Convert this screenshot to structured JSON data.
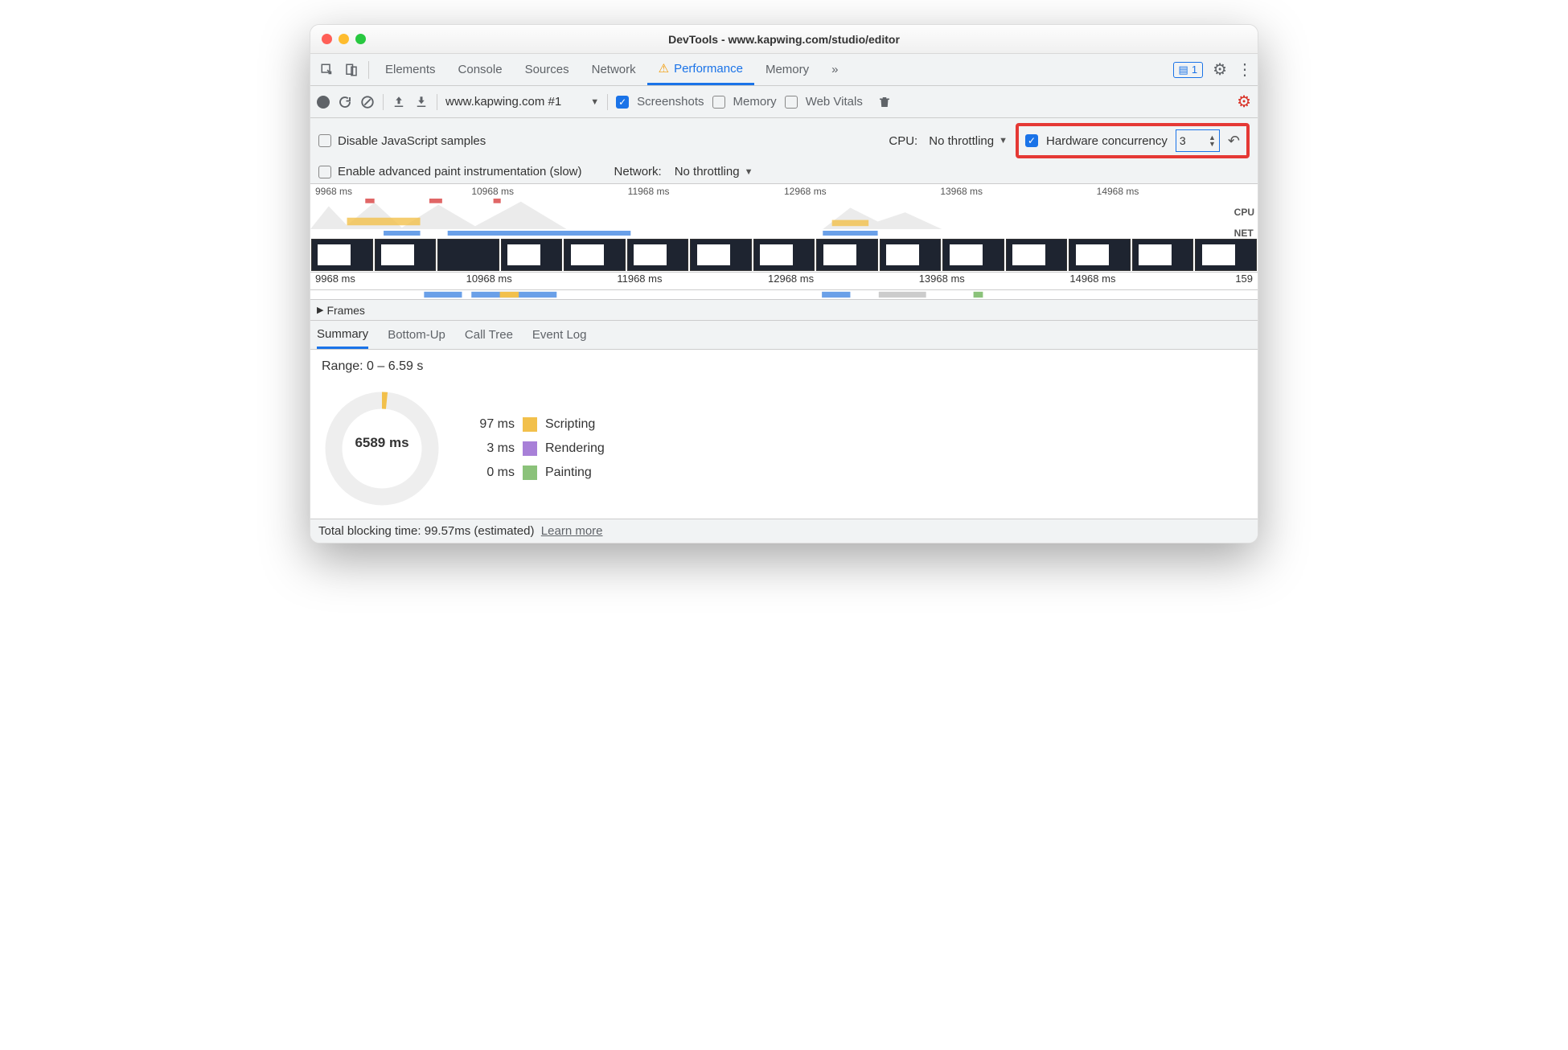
{
  "window_title": "DevTools - www.kapwing.com/studio/editor",
  "tabs": [
    "Elements",
    "Console",
    "Sources",
    "Network",
    "Performance",
    "Memory"
  ],
  "active_tab": "Performance",
  "messages_count": "1",
  "recording_target": "www.kapwing.com #1",
  "capture": {
    "screenshots_label": "Screenshots",
    "memory_label": "Memory",
    "webvitals_label": "Web Vitals",
    "screenshots_checked": true,
    "memory_checked": false,
    "webvitals_checked": false
  },
  "options": {
    "disable_js_label": "Disable JavaScript samples",
    "cpu_label": "CPU:",
    "cpu_value": "No throttling",
    "hw_label": "Hardware concurrency",
    "hw_value": "3",
    "enable_paint_label": "Enable advanced paint instrumentation (slow)",
    "network_label": "Network:",
    "network_value": "No throttling"
  },
  "overview_ticks": [
    "9968 ms",
    "10968 ms",
    "11968 ms",
    "12968 ms",
    "13968 ms",
    "14968 ms"
  ],
  "overview_labels": {
    "cpu": "CPU",
    "net": "NET"
  },
  "ruler_ticks": [
    "9968 ms",
    "10968 ms",
    "11968 ms",
    "12968 ms",
    "13968 ms",
    "14968 ms",
    "159"
  ],
  "frames_label": "Frames",
  "subtabs": [
    "Summary",
    "Bottom-Up",
    "Call Tree",
    "Event Log"
  ],
  "active_subtab": "Summary",
  "summary": {
    "range_label": "Range: 0 – 6.59 s",
    "total_label": "6589 ms",
    "legend": [
      {
        "value": "97 ms",
        "name": "Scripting",
        "color": "#f2c04b"
      },
      {
        "value": "3 ms",
        "name": "Rendering",
        "color": "#a880d8"
      },
      {
        "value": "0 ms",
        "name": "Painting",
        "color": "#8bc27a"
      }
    ]
  },
  "footer": {
    "text": "Total blocking time: 99.57ms (estimated)",
    "link": "Learn more"
  }
}
